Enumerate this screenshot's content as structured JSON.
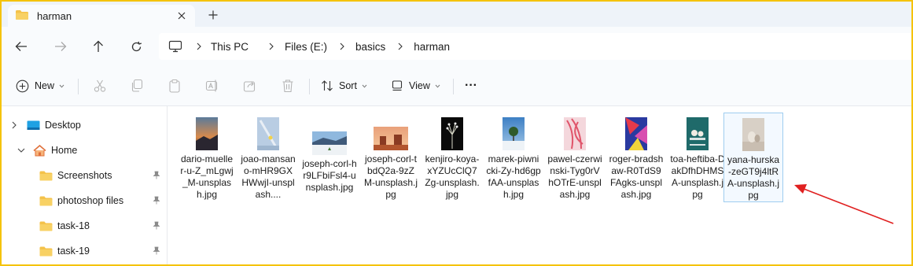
{
  "window": {
    "tab_title": "harman"
  },
  "address": {
    "crumbs": [
      "This PC",
      "Files (E:)",
      "basics",
      "harman"
    ]
  },
  "toolbar": {
    "new_label": "New",
    "sort_label": "Sort",
    "view_label": "View",
    "more_label": "···"
  },
  "sidebar": {
    "items": [
      {
        "label": "Desktop"
      },
      {
        "label": "Home"
      },
      {
        "label": "Screenshots"
      },
      {
        "label": "photoshop files"
      },
      {
        "label": "task-18"
      },
      {
        "label": "task-19"
      }
    ]
  },
  "files": [
    {
      "name": "dario-mueller-u-Z_mLgwj_M-unsplash.jpg"
    },
    {
      "name": "joao-mansano-mHR9GXHWwjI-unsplash...."
    },
    {
      "name": "joseph-corl-hr9LFbiFsl4-unsplash.jpg"
    },
    {
      "name": "joseph-corl-tbdQ2a-9zZM-unsplash.jpg"
    },
    {
      "name": "kenjiro-koya-xYZUcClQ7Zg-unsplash.jpg"
    },
    {
      "name": "marek-piwnicki-Zy-hd6gpfAA-unsplash.jpg"
    },
    {
      "name": "pawel-czerwinski-Tyg0rVhOTrE-unsplash.jpg"
    },
    {
      "name": "roger-bradshaw-R0TdS9FAgks-unsplash.jpg"
    },
    {
      "name": "toa-heftiba-DakDfhDHMSA-unsplash.jpg"
    },
    {
      "name": "yana-hurska-zeGT9j4ltRA-unsplash.jpg"
    }
  ],
  "colors": {
    "accent_border": "#f5c30a",
    "folder": "#f4c24a",
    "selection": "#9fcdf0",
    "annotation_arrow": "#e02020"
  }
}
